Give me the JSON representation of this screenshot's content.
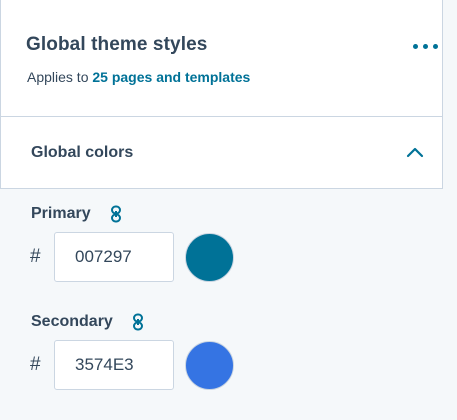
{
  "header": {
    "title": "Global theme styles",
    "subtitle_prefix": "Applies to ",
    "subtitle_link": "25 pages and templates",
    "more_icon": "more-horizontal-icon"
  },
  "section": {
    "title": "Global colors",
    "expanded": true,
    "toggle_icon": "chevron-up-icon"
  },
  "colors": [
    {
      "label": "Primary",
      "hash": "#",
      "value": "007297",
      "swatch_color": "#007297",
      "link_icon": "link-icon"
    },
    {
      "label": "Secondary",
      "hash": "#",
      "value": "3574E3",
      "swatch_color": "#3574E3",
      "link_icon": "link-icon"
    }
  ],
  "theme": {
    "accent": "#007297",
    "text": "#33475b",
    "border": "#cbd6e2",
    "background": "#f5f8fa"
  }
}
